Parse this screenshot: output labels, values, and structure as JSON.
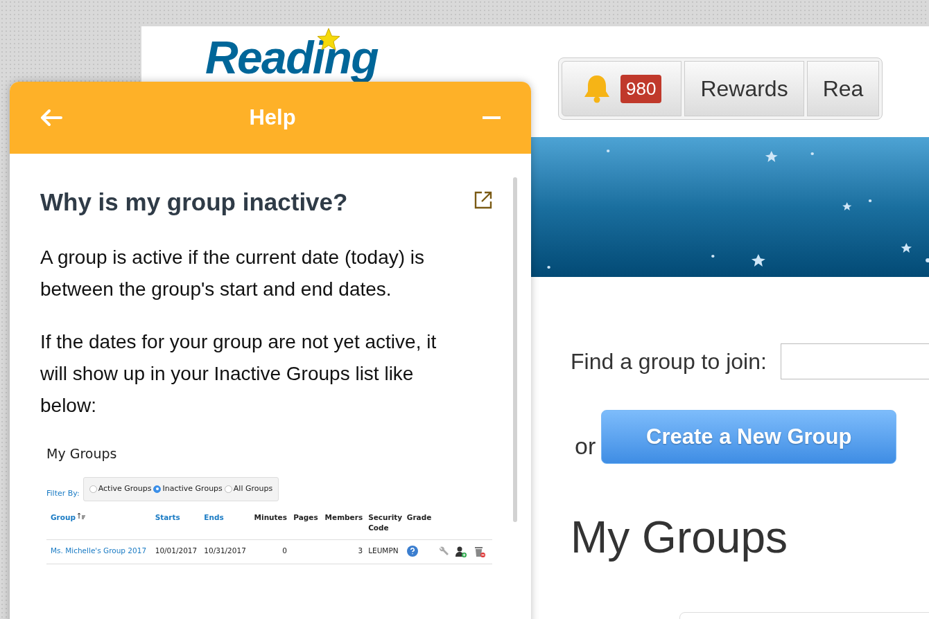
{
  "header": {
    "logo": "Reading",
    "notifications": {
      "count": "980"
    },
    "nav": [
      "Rewards",
      "Rea"
    ]
  },
  "main": {
    "find_label": "Find a group to join:",
    "or_label": "or",
    "create_button": "Create a New Group",
    "heading": "My Groups"
  },
  "help": {
    "title": "Help",
    "article_title": "Why is my group inactive?",
    "paragraphs": [
      "A group is active if the current date (today) is between the group's start and end dates.",
      "If the dates for your group are not yet active, it will show up in your Inactive Groups list like below:"
    ],
    "example": {
      "title": "My Groups",
      "filter_label": "Filter By:",
      "filters": [
        {
          "label": "Active Groups",
          "selected": false
        },
        {
          "label": "Inactive Groups",
          "selected": true
        },
        {
          "label": "All Groups",
          "selected": false
        }
      ],
      "columns": [
        {
          "label": "Group",
          "sortable": true,
          "sorted": true
        },
        {
          "label": "Starts",
          "sortable": true,
          "sorted": false
        },
        {
          "label": "Ends",
          "sortable": true,
          "sorted": false
        },
        {
          "label": "Minutes",
          "sortable": false,
          "sorted": false
        },
        {
          "label": "Pages",
          "sortable": false,
          "sorted": false
        },
        {
          "label": "Members",
          "sortable": false,
          "sorted": false
        },
        {
          "label": "Security Code",
          "sortable": false,
          "sorted": false
        },
        {
          "label": "Grade",
          "sortable": false,
          "sorted": false
        }
      ],
      "rows": [
        {
          "group": "Ms. Michelle's Group 2017",
          "starts": "10/01/2017",
          "ends": "10/31/2017",
          "minutes": "0",
          "members": "3",
          "security_code": "LEUMPN"
        }
      ]
    }
  }
}
